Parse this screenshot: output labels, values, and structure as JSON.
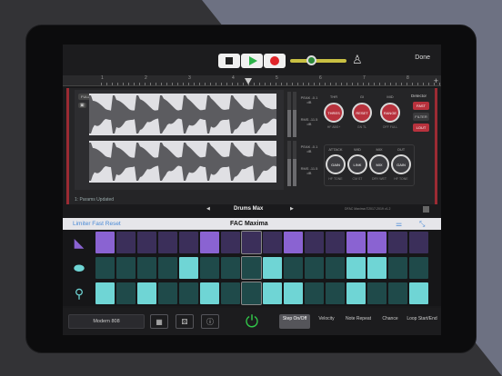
{
  "transport": {
    "done_label": "Done"
  },
  "ruler": {
    "marks": [
      "1",
      "2",
      "3",
      "4",
      "5",
      "6",
      "7",
      "8"
    ]
  },
  "plugin": {
    "full_label": "FULL",
    "status": "1: Params Updated",
    "meters": [
      {
        "label": "PEAK -0.1 dB"
      },
      {
        "label": "RMS -11.5 dB"
      },
      {
        "label": "PEAK -0.1 dB"
      },
      {
        "label": "RMS -11.5 dB"
      }
    ],
    "knobs_top": [
      {
        "label": "THR",
        "text": "THRES",
        "sub": "HF  ABS+"
      },
      {
        "label": "GI",
        "text": "RESET",
        "sub": "GN  TL"
      },
      {
        "label": "MID",
        "text": "RANGE",
        "sub": "OFF  FULL"
      }
    ],
    "detector": {
      "title": "Detector",
      "buttons": [
        "FAST",
        "FILTER",
        "LOUT"
      ]
    },
    "knobs_bottom": [
      {
        "label": "ATTACK",
        "text": "GAIN",
        "sub": "HF  TONE"
      },
      {
        "label": "WID",
        "text": "LINK",
        "sub": "CM  ST"
      },
      {
        "label": "MIX",
        "text": "MIX",
        "sub": "DRY  WET"
      },
      {
        "label": "OUT",
        "text": "GAIN",
        "sub": "HF  TONE"
      }
    ],
    "preset_name": "Drums Max",
    "copyright": "DFAC Maxima ©2017-2019 v1.2"
  },
  "titlebar": {
    "reset_label": "Limiter Fast Reset",
    "title": "FAC Maxima"
  },
  "grid": {
    "rows": [
      {
        "icon": "cowbell-icon",
        "glyph": "◣",
        "color": "#8a63d2"
      },
      {
        "icon": "cymbal-icon",
        "glyph": "⬬",
        "color": "#6fd5d5"
      },
      {
        "icon": "shaker-icon",
        "glyph": "⚲",
        "color": "#6fd5d5"
      }
    ],
    "pattern": [
      [
        1,
        0,
        0,
        0,
        0,
        1,
        0,
        0,
        0,
        1,
        0,
        0,
        1,
        1,
        0,
        0,
        1,
        0,
        0,
        0
      ],
      [
        0,
        0,
        0,
        0,
        1,
        0,
        0,
        0,
        1,
        0,
        0,
        0,
        1,
        1,
        0,
        0,
        0,
        1,
        0,
        0
      ],
      [
        1,
        0,
        1,
        0,
        0,
        1,
        0,
        0,
        1,
        1,
        0,
        0,
        1,
        0,
        0,
        1,
        0,
        1,
        0,
        0
      ]
    ]
  },
  "bottom": {
    "kit_name": "Modern 808",
    "modes": [
      {
        "label": "Step On/Off",
        "active": true
      },
      {
        "label": "Velocity",
        "active": false
      },
      {
        "label": "Note Repeat",
        "active": false
      },
      {
        "label": "Chance",
        "active": false
      },
      {
        "label": "Loop Start/End",
        "active": false
      }
    ]
  },
  "colors": {
    "accent_red": "#b8323d",
    "accent_blue": "#4a8ad6",
    "play_green": "#2db34a",
    "cell_purple_on": "#8a63d2",
    "cell_cyan_on": "#6fd5d5"
  }
}
